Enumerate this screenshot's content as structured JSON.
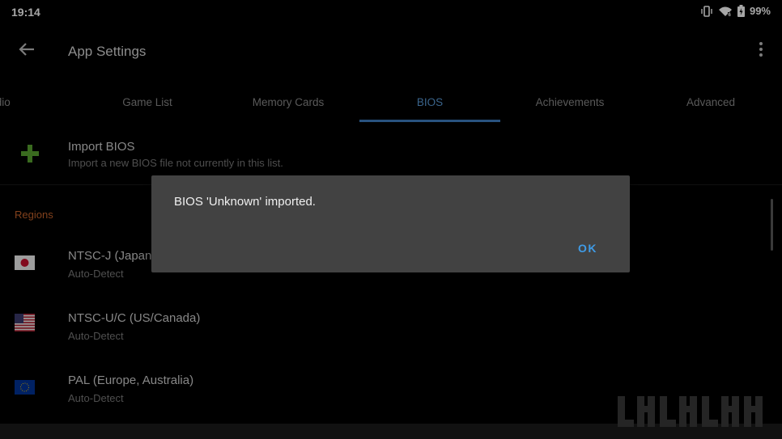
{
  "status_bar": {
    "time": "19:14",
    "battery_text": "99%",
    "icons": [
      "vibrate-icon",
      "wifi-icon",
      "battery-charging-icon"
    ]
  },
  "app_bar": {
    "title": "App Settings",
    "back_icon": "arrow-left-icon",
    "menu_icon": "more-vert-icon"
  },
  "tabs": [
    {
      "label": "udio",
      "active": false
    },
    {
      "label": "Game List",
      "active": false
    },
    {
      "label": "Memory Cards",
      "active": false
    },
    {
      "label": "BIOS",
      "active": true
    },
    {
      "label": "Achievements",
      "active": false
    },
    {
      "label": "Advanced",
      "active": false
    }
  ],
  "import": {
    "title": "Import BIOS",
    "subtitle": "Import a new BIOS file not currently in this list.",
    "icon": "plus-icon"
  },
  "regions": {
    "heading": "Regions",
    "items": [
      {
        "title": "NTSC-J (Japan)",
        "value": "Auto-Detect",
        "icon": "japan-flag-icon"
      },
      {
        "title": "NTSC-U/C (US/Canada)",
        "value": "Auto-Detect",
        "icon": "us-flag-icon"
      },
      {
        "title": "PAL (Europe, Australia)",
        "value": "Auto-Detect",
        "icon": "eu-flag-icon"
      }
    ]
  },
  "dialog": {
    "message": "BIOS 'Unknown' imported.",
    "ok_label": "OK"
  },
  "colors": {
    "accent": "#3f7fc4",
    "section_header": "#c8642c",
    "plus": "#5aa531",
    "dialog_bg": "#424242"
  }
}
